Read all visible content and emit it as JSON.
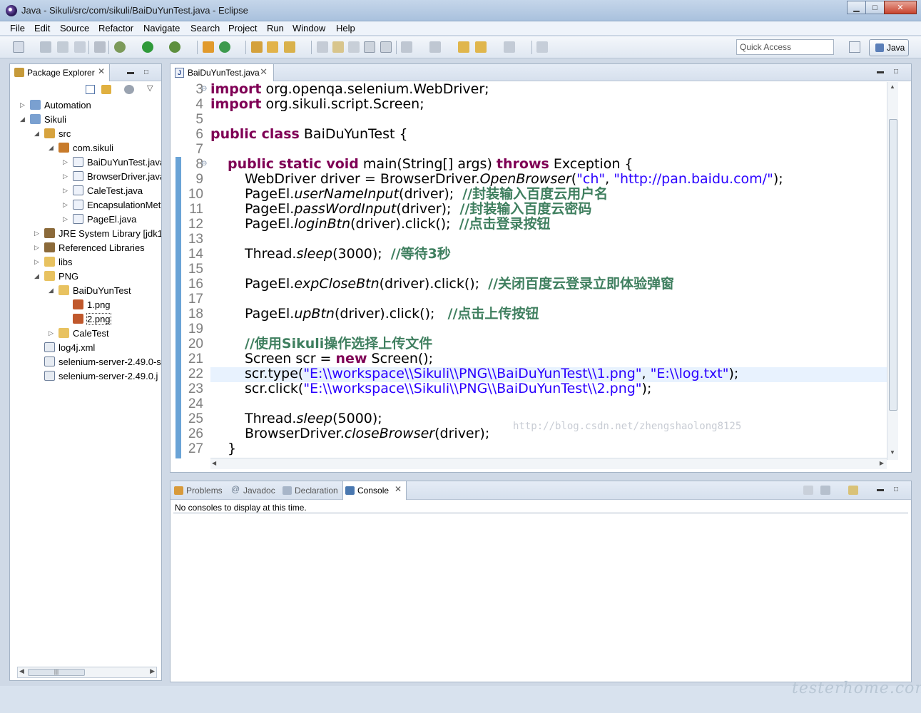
{
  "window": {
    "title": "Java - Sikuli/src/com/sikuli/BaiDuYunTest.java - Eclipse",
    "min": "▁",
    "max": "□",
    "close": "✕"
  },
  "menu": [
    "File",
    "Edit",
    "Source",
    "Refactor",
    "Navigate",
    "Search",
    "Project",
    "Run",
    "Window",
    "Help"
  ],
  "toolbar": {
    "quick_access_placeholder": "Quick Access",
    "perspective": "Java"
  },
  "package_explorer": {
    "title": "Package Explorer",
    "tree": [
      {
        "label": "Automation",
        "level": 0,
        "expanded": false
      },
      {
        "label": "Sikuli",
        "level": 0,
        "expanded": true
      },
      {
        "label": "src",
        "level": 1,
        "expanded": true
      },
      {
        "label": "com.sikuli",
        "level": 2,
        "expanded": true
      },
      {
        "label": "BaiDuYunTest.java",
        "level": 3,
        "expanded": false
      },
      {
        "label": "BrowserDriver.java",
        "level": 3,
        "expanded": false
      },
      {
        "label": "CaleTest.java",
        "level": 3,
        "expanded": false
      },
      {
        "label": "EncapsulationMethod.java",
        "level": 3,
        "expanded": false
      },
      {
        "label": "PageEl.java",
        "level": 3,
        "expanded": false
      },
      {
        "label": "JRE System Library [jdk1",
        "level": 1,
        "expanded": false
      },
      {
        "label": "Referenced Libraries",
        "level": 1,
        "expanded": false
      },
      {
        "label": "libs",
        "level": 1,
        "expanded": false
      },
      {
        "label": "PNG",
        "level": 1,
        "expanded": true
      },
      {
        "label": "BaiDuYunTest",
        "level": 2,
        "expanded": true
      },
      {
        "label": "1.png",
        "level": 3
      },
      {
        "label": "2.png",
        "level": 3
      },
      {
        "label": "CaleTest",
        "level": 2,
        "expanded": false
      },
      {
        "label": "log4j.xml",
        "level": 1
      },
      {
        "label": "selenium-server-2.49.0-s",
        "level": 1
      },
      {
        "label": "selenium-server-2.49.0.j",
        "level": 1
      }
    ]
  },
  "editor": {
    "tab": "BaiDuYunTest.java",
    "line_numbers": [
      "3",
      "4",
      "5",
      "6",
      "7",
      "8",
      "9",
      "10",
      "11",
      "12",
      "13",
      "14",
      "15",
      "16",
      "17",
      "18",
      "19",
      "20",
      "21",
      "22",
      "23",
      "24",
      "25",
      "26",
      "27"
    ],
    "lines": {
      "l3a": "import",
      " l3b": "",
      "l3": " org.openqa.selenium.WebDriver;",
      "l4": " org.sikuli.script.Screen;",
      "l6a": "public class",
      "l6": " BaiDuYunTest {",
      "l8a": "public static void",
      "l8b": " main(String[] args) ",
      "l8c": "throws",
      "l8d": " Exception {",
      "l9a": "WebDriver driver = BrowserDriver.",
      "l9b": "OpenBrowser",
      "l9c": "(",
      "l9d": "\"ch\"",
      "l9e": ", ",
      "l9f": "\"http://pan.baidu.com/\"",
      "l9g": ");",
      "l10a": "PageEl.",
      "l10b": "userNameInput",
      "l10c": "(driver);  ",
      "l10d": "//封装输入百度云用户名",
      "l11a": "PageEl.",
      "l11b": "passWordInput",
      "l11c": "(driver);  ",
      "l11d": "//封装输入百度云密码",
      "l12a": "PageEl.",
      "l12b": "loginBtn",
      "l12c": "(driver).click();  ",
      "l12d": "//点击登录按钮",
      "l14a": "Thread.",
      "l14b": "sleep",
      "l14c": "(3000);  ",
      "l14d": "//等待3秒",
      "l16a": "PageEl.",
      "l16b": "expCloseBtn",
      "l16c": "(driver).click();  ",
      "l16d": "//关闭百度云登录立即体验弹窗",
      "l18a": "PageEl.",
      "l18b": "upBtn",
      "l18c": "(driver).click();   ",
      "l18d": "//点击上传按钮",
      "l20": "//使用Sikuli操作选择上传文件",
      "l21a": "Screen scr = ",
      "l21b": "new",
      "l21c": " Screen();",
      "l22a": "scr.type(",
      "l22b": "\"E:\\\\workspace\\\\Sikuli\\\\PNG\\\\BaiDuYunTest\\\\1.png\"",
      "l22c": ", ",
      "l22d": "\"E:\\\\log.txt\"",
      "l22e": ");",
      "l23a": "scr.click(",
      "l23b": "\"E:\\\\workspace\\\\Sikuli\\\\PNG\\\\BaiDuYunTest\\\\2.png\"",
      "l23c": ");",
      "l25a": "Thread.",
      "l25b": "sleep",
      "l25c": "(5000);",
      "l26a": "BrowserDriver.",
      "l26b": "closeBrowser",
      "l26c": "(driver);",
      "l27": "}"
    },
    "watermark": "http://blog.csdn.net/zhengshaolong8125"
  },
  "bottom": {
    "tabs": [
      "Problems",
      "Javadoc",
      "Declaration",
      "Console"
    ],
    "active": "Console",
    "message": "No consoles to display at this time."
  },
  "footer_watermark": "testerhome.com"
}
